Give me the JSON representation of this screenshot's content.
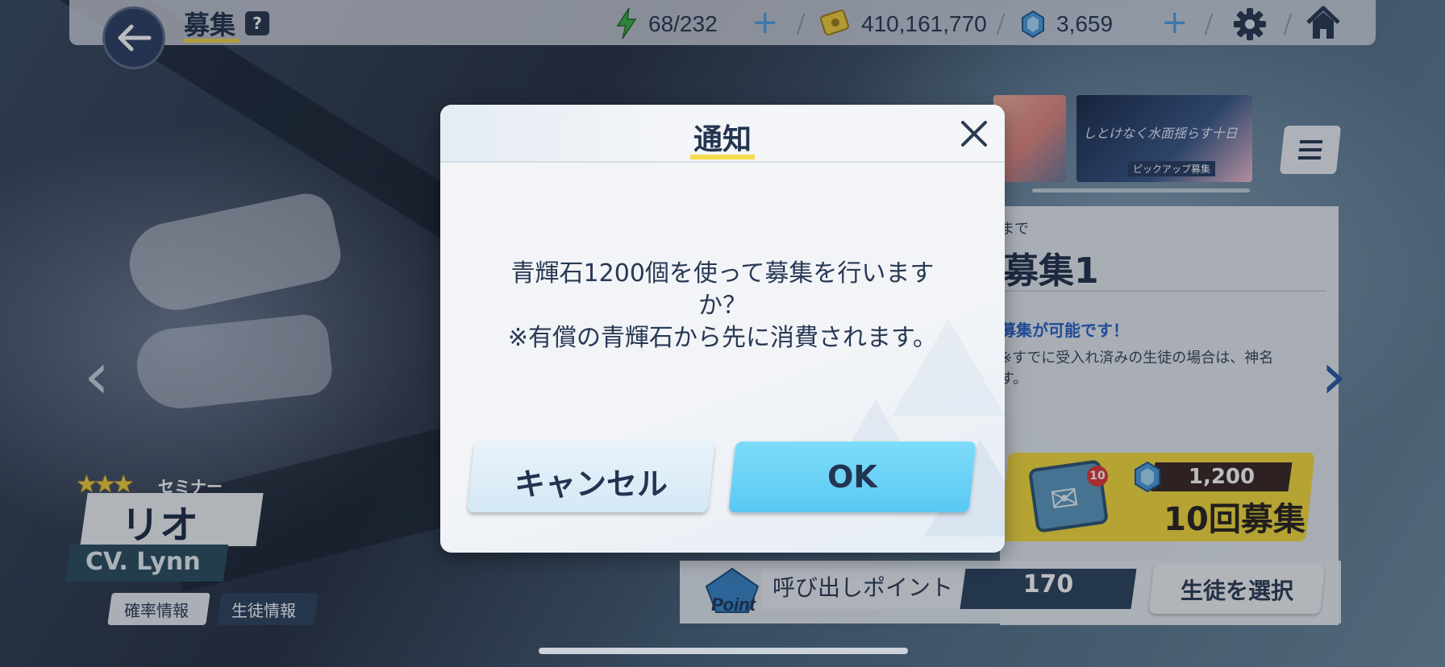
{
  "header": {
    "title": "募集",
    "help": "?",
    "ap": "68/232",
    "credits": "410,161,770",
    "gems": "3,659",
    "plus": "+"
  },
  "banners": {
    "banner_b_text": "しとけなく水面揺らす十日",
    "banner_b_tag": "ピックアップ募集"
  },
  "recruit_panel": {
    "until": "まで",
    "name": "募集1",
    "info_line1": "募集が可能です！",
    "info_line2": "※すでに受入れ済みの生徒の場合は、神名\nす。",
    "ten_cost": "1,200",
    "ten_badge": "10",
    "ten_label": "10回募集",
    "point_label": "呼び出しポイント",
    "point_value": "170",
    "select_student": "生徒を選択"
  },
  "character": {
    "stars": "★★★",
    "rank": "セミナー",
    "name": "リオ",
    "cv": "CV. Lynn",
    "rate_info": "確率情報",
    "student_info": "生徒情報"
  },
  "dialog": {
    "title": "通知",
    "message_line1": "青輝石1200個を使って募集を行います",
    "message_line2": "か？",
    "message_line3": "※有償の青輝石から先に消費されます。",
    "cancel": "キャンセル",
    "ok": "OK"
  },
  "nav": {
    "left": "‹",
    "right": "›"
  },
  "colors": {
    "accent_yellow": "#f4dc4e",
    "ok_blue": "#5ac8f3",
    "dark_navy": "#233450"
  }
}
